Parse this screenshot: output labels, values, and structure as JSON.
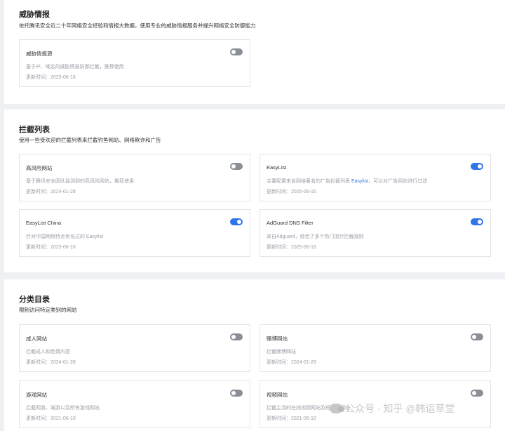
{
  "sections": [
    {
      "title": "威胁情报",
      "desc": "依托腾讯安全近二十年网络安全经验和情报大数据，使用专业的威胁情报服务并提升网络安全防御能力",
      "cards": [
        {
          "name": "威胁情报源",
          "desc": "基于IP、域名的威胁情报防御拦截，推荐使用",
          "time": "更新时间：2025-06-16",
          "enabled": false
        }
      ]
    },
    {
      "title": "拦截列表",
      "desc": "使用一些受欢迎的拦截列表来拦截钓鱼网站、网络欺诈和广告",
      "cards": [
        {
          "name": "高风险网站",
          "desc": "基于腾讯安全团队监测到的高风险网站，推荐使用",
          "time": "更新时间：2024-01-28",
          "enabled": false
        },
        {
          "name": "EasyList",
          "desc_pre": "主要配置来自网络著名的广告拦截列表 ",
          "desc_hl": "Easylist",
          "desc_post": "，可以对广告网站进行过滤",
          "time": "更新时间：2025-06-16",
          "enabled": true
        },
        {
          "name": "EasyList China",
          "desc": "针对中国网络特点优化过的 Easylist",
          "time": "更新时间：2025-06-16",
          "enabled": true
        },
        {
          "name": "AdGuard DNS Filter",
          "desc": "来自Adguard，综合了多个热门流行拦截规则",
          "time": "更新时间：2025-06-16",
          "enabled": true
        }
      ]
    },
    {
      "title": "分类目录",
      "desc": "限制访问特定类别的网站",
      "cards": [
        {
          "name": "成人网站",
          "desc": "拦截成人和色情内容",
          "time": "更新时间：2024-01-28",
          "enabled": false
        },
        {
          "name": "赌博网站",
          "desc": "拦截赌博网站",
          "time": "更新时间：2024-01-28",
          "enabled": false
        },
        {
          "name": "游戏网站",
          "desc": "拦截网游、端游以及所有游戏网站",
          "time": "更新时间：2021-06-10",
          "enabled": false
        },
        {
          "name": "视频网站",
          "desc": "拦截主流的在线视频网站及短视频网站",
          "time": "更新时间：2021-06-10",
          "enabled": false
        }
      ]
    }
  ],
  "watermark": {
    "text": "公众号 · 知乎 @韩运草堂"
  },
  "colors": {
    "toggle_on": "#2f74e8",
    "toggle_off": "#8a8e96",
    "link": "#3b73d9"
  }
}
